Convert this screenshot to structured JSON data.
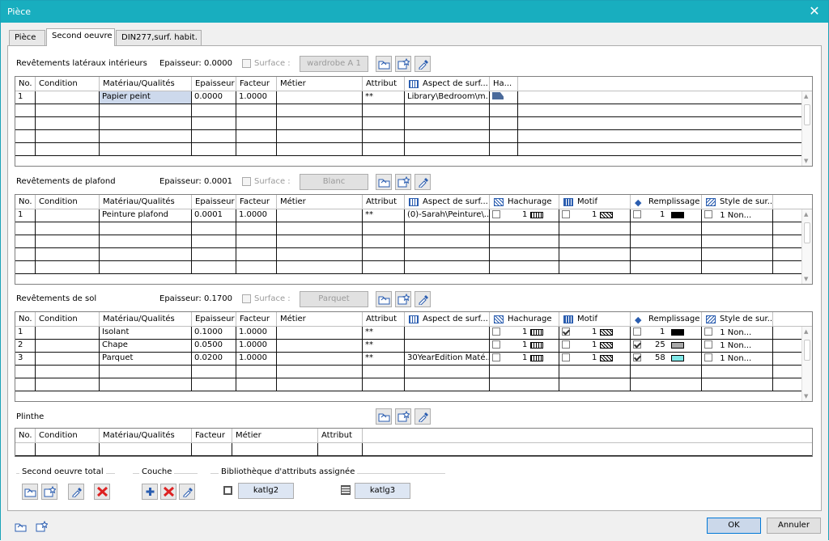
{
  "window": {
    "title": "Pièce",
    "close_glyph": "✕"
  },
  "tabs": [
    {
      "label": "Pièce"
    },
    {
      "label": "Second oeuvre"
    },
    {
      "label": "DIN277,surf. habit."
    }
  ],
  "sections": {
    "walls": {
      "title": "Revêtements latéraux intérieurs",
      "epaisseur_label": "Epaisseur:",
      "epaisseur_value": "0.0000",
      "surface_label": "Surface :",
      "surface_button": "wardrobe A 1",
      "headers": [
        "No.",
        "Condition",
        "Matériau/Qualités",
        "Epaisseur",
        "Facteur",
        "Métier",
        "Attribut",
        "Aspect de surf...",
        "Ha..."
      ],
      "rows": [
        {
          "no": "1",
          "condition": "",
          "materiau": "Papier peint",
          "epaisseur": "0.0000",
          "facteur": "1.0000",
          "metier": "",
          "attribut": "**",
          "aspect": "Library\\Bedroom\\m..."
        }
      ]
    },
    "ceiling": {
      "title": "Revêtements de plafond",
      "epaisseur_label": "Epaisseur:",
      "epaisseur_value": "0.0001",
      "surface_label": "Surface :",
      "surface_button": "Blanc",
      "headers": [
        "No.",
        "Condition",
        "Matériau/Qualités",
        "Epaisseur",
        "Facteur",
        "Métier",
        "Attribut",
        "Aspect de surf...",
        "Hachurage",
        "Motif",
        "Remplissage",
        "Style de sur..."
      ],
      "rows": [
        {
          "no": "1",
          "condition": "",
          "materiau": "Peinture plafond",
          "epaisseur": "0.0001",
          "facteur": "1.0000",
          "metier": "",
          "attribut": "**",
          "aspect": "(0)-Sarah\\Peinture\\...",
          "hach_num": "1",
          "motif_num": "1",
          "rempl_num": "1",
          "rempl_color": "#000000",
          "style": "1 Non..."
        }
      ]
    },
    "floor": {
      "title": "Revêtements de sol",
      "epaisseur_label": "Epaisseur:",
      "epaisseur_value": "0.1700",
      "surface_label": "Surface :",
      "surface_button": "Parquet",
      "headers": [
        "No.",
        "Condition",
        "Matériau/Qualités",
        "Epaisseur",
        "Facteur",
        "Métier",
        "Attribut",
        "Aspect de surf...",
        "Hachurage",
        "Motif",
        "Remplissage",
        "Style de sur..."
      ],
      "rows": [
        {
          "no": "1",
          "condition": "",
          "materiau": "Isolant",
          "epaisseur": "0.1000",
          "facteur": "1.0000",
          "metier": "",
          "attribut": "**",
          "aspect": "",
          "hach_num": "1",
          "motif_checked": true,
          "motif_num": "1",
          "rempl_checked": false,
          "rempl_num": "1",
          "rempl_color": "#000000",
          "style": "1 Non..."
        },
        {
          "no": "2",
          "condition": "",
          "materiau": "Chape",
          "epaisseur": "0.0500",
          "facteur": "1.0000",
          "metier": "",
          "attribut": "**",
          "aspect": "",
          "hach_num": "1",
          "motif_checked": false,
          "motif_num": "1",
          "rempl_checked": true,
          "rempl_num": "25",
          "rempl_color": "#a8a8a8",
          "style": "1 Non..."
        },
        {
          "no": "3",
          "condition": "",
          "materiau": "Parquet",
          "epaisseur": "0.0200",
          "facteur": "1.0000",
          "metier": "",
          "attribut": "**",
          "aspect": "30YearEdition Maté...",
          "hach_num": "1",
          "motif_checked": false,
          "motif_num": "1",
          "rempl_checked": true,
          "rempl_num": "58",
          "rempl_color": "#7fe8e8",
          "style": "1 Non..."
        }
      ]
    },
    "plinthe": {
      "title": "Plinthe",
      "headers": [
        "No.",
        "Condition",
        "Matériau/Qualités",
        "Facteur",
        "Métier",
        "Attribut"
      ]
    }
  },
  "groups": {
    "second_oeuvre": "Second oeuvre total",
    "couche": "Couche",
    "biblio": "Bibliothèque d'attributs assignée",
    "katlg2": "katlg2",
    "katlg3": "katlg3"
  },
  "footer": {
    "ok": "OK",
    "cancel": "Annuler"
  }
}
